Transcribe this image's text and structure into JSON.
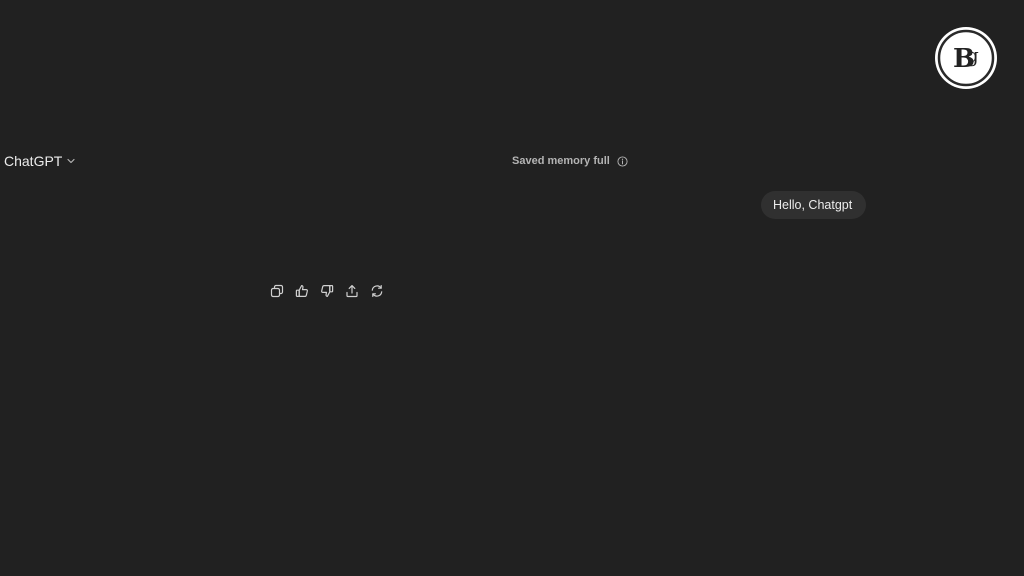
{
  "header": {
    "model_name": "ChatGPT",
    "memory_status": "Saved memory full"
  },
  "conversation": {
    "user_message": "Hello, Chatgpt"
  },
  "message_actions": [
    {
      "icon": "copy-icon"
    },
    {
      "icon": "thumbs-up-icon"
    },
    {
      "icon": "thumbs-down-icon"
    },
    {
      "icon": "share-icon"
    },
    {
      "icon": "regenerate-icon"
    }
  ],
  "watermark": {
    "logo_text": "Bg",
    "icon": "brand-logo"
  },
  "colors": {
    "background": "#212121",
    "bubble": "#303030",
    "text": "#ececec",
    "muted_text": "#b4b4b4"
  }
}
